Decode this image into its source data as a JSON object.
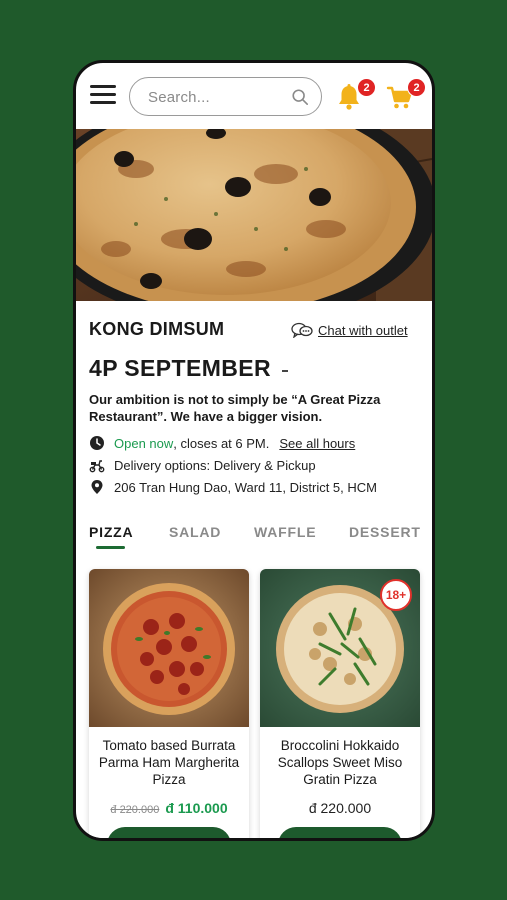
{
  "header": {
    "search_placeholder": "Search...",
    "notification_count": "2",
    "cart_count": "2"
  },
  "restaurant": {
    "name": "KONG DIMSUM",
    "chat_label": "Chat with outlet",
    "branch": "4P SEPTEMBER",
    "tagline": "Our ambition is not to simply be “A Great Pizza Restaurant”. We have a bigger vision.",
    "status": "Open now",
    "closing": ", closes at 6 PM.",
    "hours_link": "See all hours",
    "delivery": "Delivery options: Delivery & Pickup",
    "address": "206 Tran Hung Dao, Ward 11, District 5, HCM"
  },
  "tabs": [
    "PIZZA",
    "SALAD",
    "WAFFLE",
    "DESSERT"
  ],
  "active_tab": "PIZZA",
  "products": [
    {
      "title": "Tomato based Burrata Parma Ham Margherita Pizza",
      "old_price": "đ 220.000",
      "price": "đ 110.000"
    },
    {
      "title": "Broccolini Hokkaido Scallops Sweet Miso Gratin Pizza",
      "price": "đ 220.000",
      "age_badge": "18+"
    }
  ],
  "colors": {
    "background": "#1f5a2b",
    "accent_green": "#1b9a4f",
    "badge_red": "#e02424",
    "bell_yellow": "#f2b21b"
  },
  "icons": [
    "menu-icon",
    "search-icon",
    "bell-icon",
    "cart-icon",
    "chat-icon",
    "clock-icon",
    "scooter-icon",
    "location-pin-icon"
  ]
}
